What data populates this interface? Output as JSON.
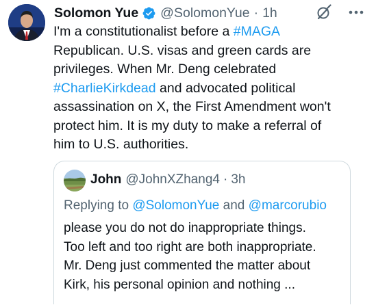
{
  "author": {
    "display_name": "Solomon Yue",
    "handle": "@SolomonYue",
    "separator": "·",
    "time": "1h"
  },
  "tweet": {
    "lines": [
      {
        "pre": "I'm a constitutionalist before a ",
        "tag": "#MAGA",
        "post": ""
      },
      {
        "pre": "Republican. U.S. visas and green cards are",
        "tag": "",
        "post": ""
      },
      {
        "pre": "privileges. When Mr. Deng celebrated",
        "tag": "",
        "post": ""
      },
      {
        "pre": "",
        "tag": "#CharlieKirkdead",
        "post": " and advocated political"
      },
      {
        "pre": "assassination on X, the First Amendment won't",
        "tag": "",
        "post": ""
      },
      {
        "pre": "protect him. It is my duty to make a referral of",
        "tag": "",
        "post": ""
      },
      {
        "pre": "him to U.S. authorities.",
        "tag": "",
        "post": ""
      }
    ]
  },
  "quote": {
    "display_name": "John",
    "handle": "@JohnXZhang4",
    "separator": "·",
    "time": "3h",
    "replying_prefix": "Replying to ",
    "replying_mention_1": "@SolomonYue",
    "replying_and": " and ",
    "replying_mention_2": "@marcorubio",
    "lines": [
      "please you do not do inappropriate things.",
      "Too left and too right are both inappropriate.",
      "Mr. Deng just commented the matter about",
      "Kirk, his personal opinion and nothing ..."
    ]
  },
  "icons": {
    "verified": "verified-badge-icon",
    "grok": "grok-icon",
    "more": "more-options-icon"
  },
  "colors": {
    "link": "#1d9bf0",
    "secondary_text": "#536471",
    "primary_text": "#0f1419",
    "border": "#cfd9de"
  }
}
